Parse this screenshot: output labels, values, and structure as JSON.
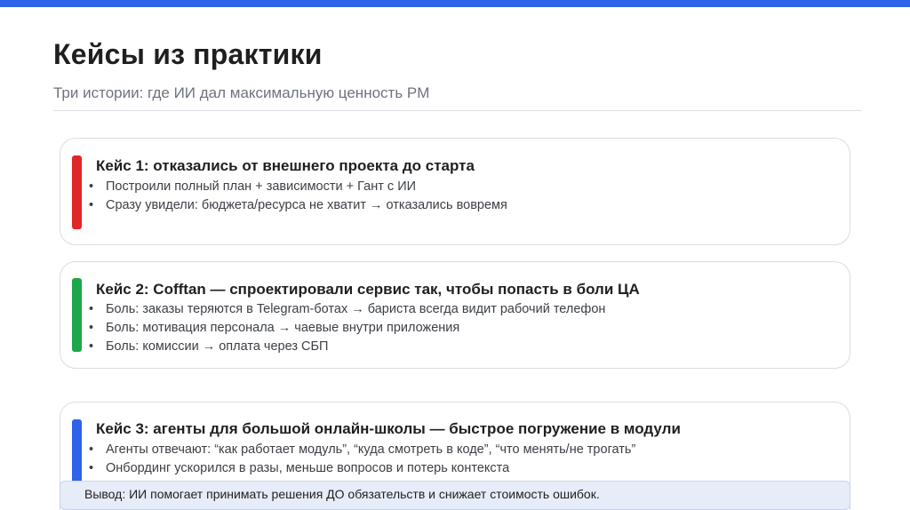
{
  "slide": {
    "title": "Кейсы из практики",
    "subtitle": "Три истории: где ИИ дал максимальную ценность PM",
    "colors": {
      "top_bar": "#2e62e8",
      "case1_accent": "#e02626",
      "case2_accent": "#1ea64a",
      "case3_accent": "#2e62e8"
    }
  },
  "cases": [
    {
      "title": "Кейс 1: отказались от внешнего проекта до старта",
      "bullets": [
        "Построили полный план + зависимости + Гант с ИИ",
        "Сразу увидели: бюджета/ресурса не хватит → отказались вовремя"
      ]
    },
    {
      "title": "Кейс 2: Cofftan — спроектировали сервис так, чтобы попасть в боли ЦА",
      "bullets": [
        "Боль: заказы теряются в Telegram-ботах → бариста всегда видит рабочий телефон",
        "Боль: мотивация персонала → чаевые внутри приложения",
        "Боль: комиссии → оплата через СБП"
      ]
    },
    {
      "title": "Кейс 3: агенты для большой онлайн-школы — быстрое погружение в модули",
      "bullets": [
        "Агенты отвечают: “как работает модуль”, “куда смотреть в коде”, “что менять/не трогать”",
        "Онбординг ускорился в разы, меньше вопросов и потерь контекста"
      ]
    }
  ],
  "conclusion": "Вывод: ИИ помогает принимать решения ДО обязательств и снижает стоимость ошибок.",
  "bullet_symbol": "•"
}
